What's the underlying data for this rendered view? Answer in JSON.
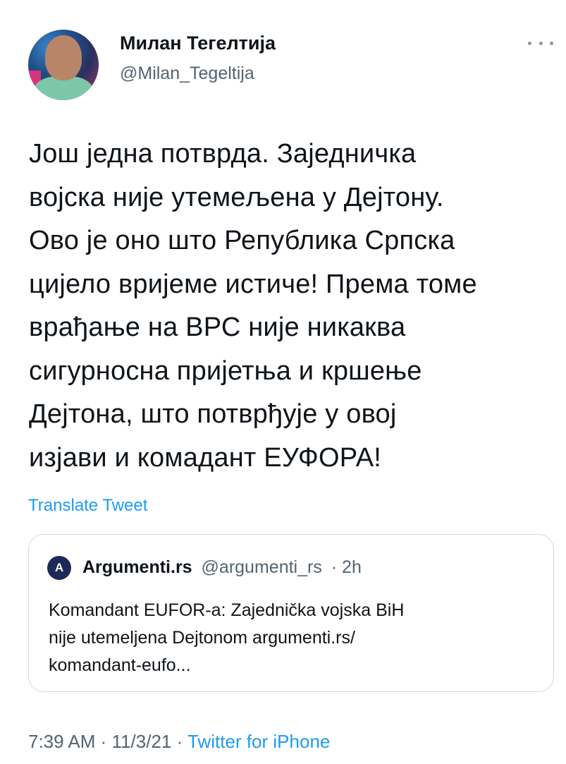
{
  "author": {
    "name": "Милан Тегелтија",
    "handle": "@Milan_Tegeltija",
    "avatar": "avatar"
  },
  "more_icon": "ellipsis-icon",
  "tweet": {
    "text": "Још једна потврда. Заједничка\nвојска није утемељена у Дејтону.\nОво је оно што Република Српска\nцијело вријеме истиче! Према томе\nврађање на ВРС није никаква\nсигурносна пријетња и кршење\nДејтона, што потврђује у овој\nизјави и комадант ЕУФОРА!",
    "translate_label": "Translate Tweet"
  },
  "quoted_tweet": {
    "avatar_letter": "A",
    "name": "Argumenti.rs",
    "handle": "@argumenti_rs",
    "time": "· 2h",
    "text": "Komandant EUFOR-a: Zajednička vojska BiH\nnije utemeljena Dejtonom argumenti.rs/\nkomandant-eufo..."
  },
  "meta": {
    "time": "7:39 AM",
    "sep1": "·",
    "date": "11/3/21",
    "sep2": "·",
    "source": "Twitter for iPhone"
  },
  "colors": {
    "text": "#0f1419",
    "secondary": "#536471",
    "link": "#1d9bf0",
    "border": "#cfd9de"
  }
}
